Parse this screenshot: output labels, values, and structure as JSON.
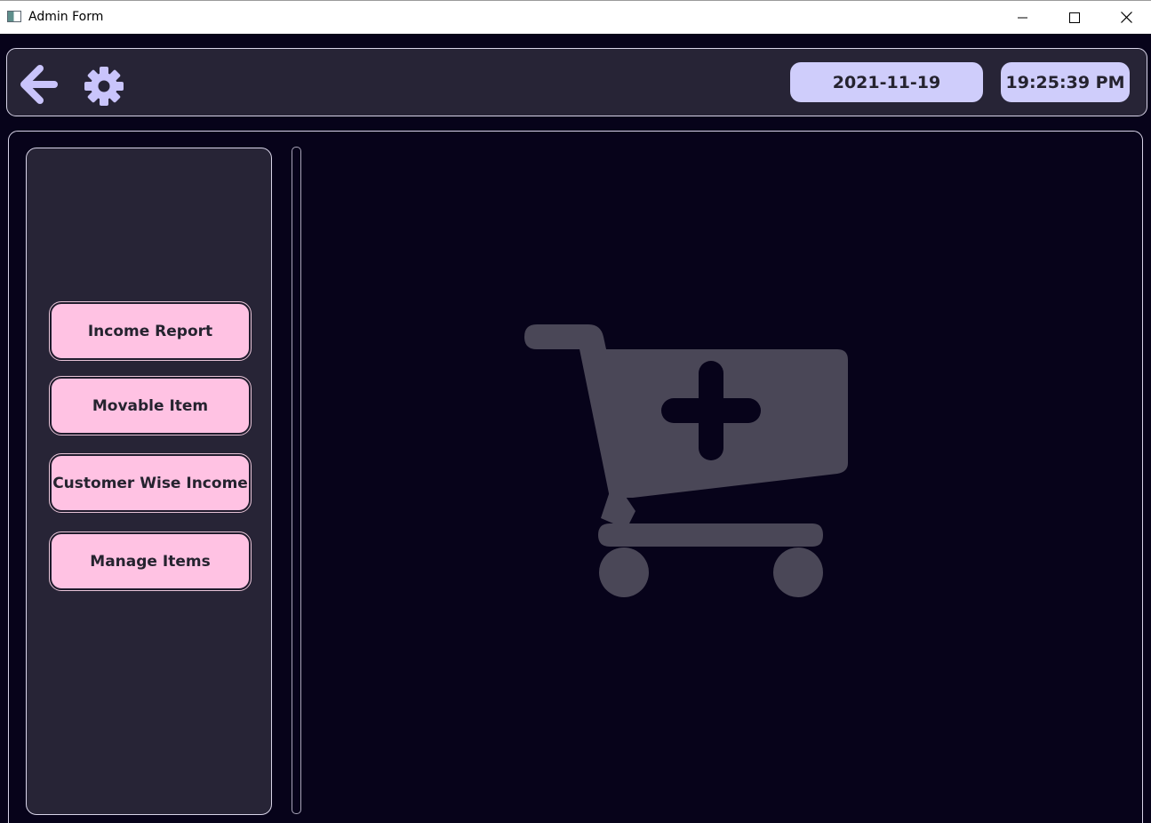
{
  "window": {
    "title": "Admin Form"
  },
  "header": {
    "back_icon": "arrow-left-icon",
    "settings_icon": "gear-icon",
    "date": "2021-11-19",
    "time": "19:25:39 PM"
  },
  "sidebar": {
    "items": [
      {
        "label": "Income Report"
      },
      {
        "label": "Movable Item"
      },
      {
        "label": "Customer Wise Income"
      },
      {
        "label": "Manage Items"
      }
    ]
  },
  "main": {
    "placeholder_icon": "cart-plus-icon"
  },
  "colors": {
    "background": "#07031a",
    "panel": "#272436",
    "accent_pill": "#cfcdfb",
    "button_pink": "#ffc2e3",
    "icon_light": "#c9c4fb",
    "cart_gray": "#4a4757"
  }
}
